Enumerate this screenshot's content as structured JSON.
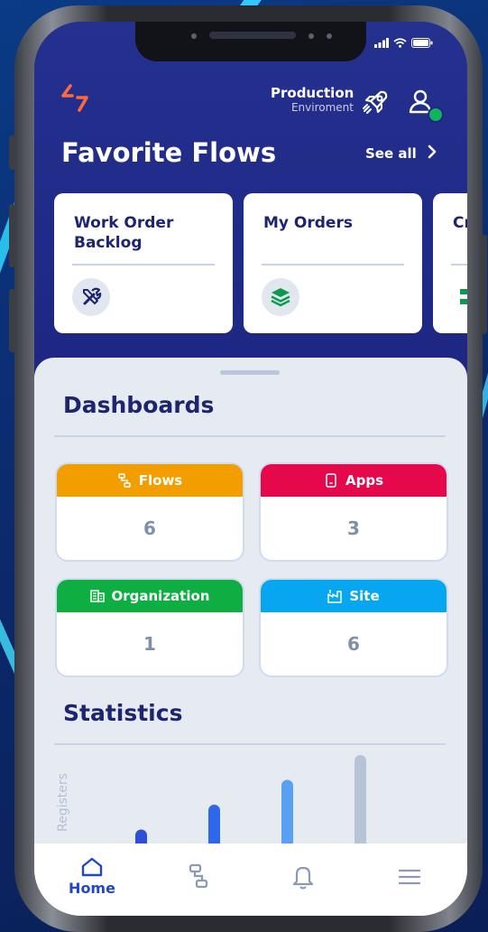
{
  "status_bar": {
    "icons": [
      "signal-icon",
      "wifi-icon",
      "battery-icon"
    ]
  },
  "header": {
    "environment_name": "Production",
    "environment_label": "Enviroment"
  },
  "favorites": {
    "title": "Favorite Flows",
    "see_all": "See all",
    "cards": [
      {
        "title": "Work Order Backlog",
        "icon": "tools-icon"
      },
      {
        "title": "My Orders",
        "icon": "layers-icon"
      },
      {
        "title": "Cr",
        "icon": "grid-icon"
      }
    ]
  },
  "dashboards": {
    "title": "Dashboards",
    "cards": [
      {
        "label": "Flows",
        "value": "6",
        "color": "#f29d00",
        "icon": "flows-icon"
      },
      {
        "label": "Apps",
        "value": "3",
        "color": "#e5084a",
        "icon": "apps-icon"
      },
      {
        "label": "Organization",
        "value": "1",
        "color": "#0fae43",
        "icon": "organization-icon"
      },
      {
        "label": "Site",
        "value": "6",
        "color": "#06a6f0",
        "icon": "site-icon"
      }
    ]
  },
  "statistics": {
    "title": "Statistics"
  },
  "chart_data": {
    "type": "bar",
    "ylabel": "Registers",
    "values": [
      1,
      2,
      3,
      4
    ],
    "colors": [
      "#2c4fd6",
      "#2e68ea",
      "#5aa0f2",
      "#b8c4d6"
    ]
  },
  "tabbar": {
    "items": [
      {
        "label": "Home",
        "icon": "home-icon",
        "active": true
      },
      {
        "label": "",
        "icon": "flows-icon"
      },
      {
        "label": "",
        "icon": "bell-icon"
      },
      {
        "label": "",
        "icon": "menu-icon"
      }
    ]
  },
  "colors": {
    "primary": "#1d2683",
    "text_dark": "#1d2470",
    "accent": "#2147c6",
    "logo": "#ff6a3d"
  }
}
